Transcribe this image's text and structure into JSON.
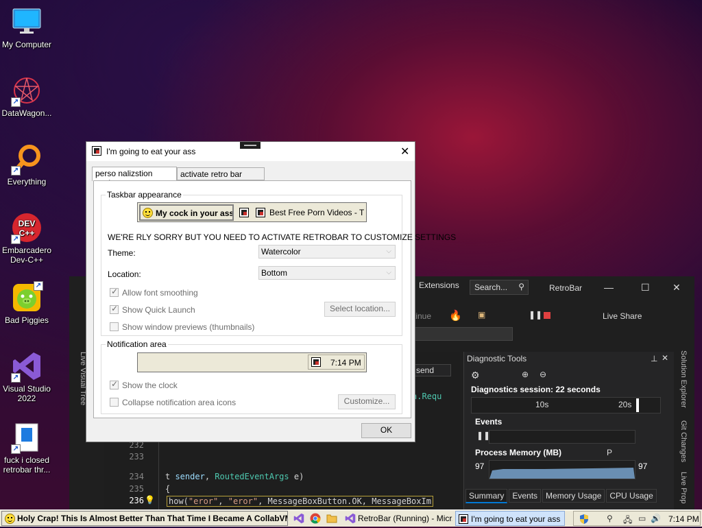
{
  "desktop": {
    "icons": [
      {
        "label": "My Computer",
        "icon": "computer-icon"
      },
      {
        "label": "DataWagon...",
        "icon": "datawagon-icon"
      },
      {
        "label": "Everything",
        "icon": "everything-search-icon"
      },
      {
        "label": "Embarcadero Dev-C++",
        "icon": "devcpp-icon",
        "badge": "DEV C++"
      },
      {
        "label": "Bad Piggies",
        "icon": "bad-piggies-icon"
      },
      {
        "label": "Visual Studio 2022",
        "icon": "visual-studio-icon"
      },
      {
        "label": "fuck i closed retrobar thr...",
        "icon": "document-icon"
      }
    ]
  },
  "vs": {
    "menu_extensions": "Extensions",
    "search": "Search...",
    "title": "RetroBar",
    "continue": "tinue",
    "live_share": "Live Share",
    "send_dropdown": "send",
    "live_visual_tree": "Live Visual Tree",
    "solution_explorer": "Solution Explorer",
    "git_changes": "Git Changes",
    "live_prop": "Live Prop",
    "code_lines": [
      {
        "num": "232",
        "text": ""
      },
      {
        "num": "233",
        "text": ""
      },
      {
        "num": "234",
        "text_a": "t ",
        "text_b": "sender",
        "text_c": ", ",
        "text_d": "RoutedEventArgs",
        "text_e": " e)"
      },
      {
        "num": "235",
        "text": "{"
      },
      {
        "num": "236",
        "text_a": "how(",
        "text_b": "\"eror\"",
        "text_c": ", ",
        "text_d": "\"eror\"",
        "text_e": ", MessageBoxButton.OK, MessageBoxIm"
      }
    ],
    "requ_fragment": "n.Requ",
    "diagnostics": {
      "title": "Diagnostic Tools",
      "session": "Diagnostics session: 22 seconds",
      "tick1": "10s",
      "tick2": "20s",
      "events": "Events",
      "process_memory": "Process Memory (MB)",
      "mem_left": "97",
      "mem_right": "97",
      "legend_p": "P",
      "tabs": [
        "Summary",
        "Events",
        "Memory Usage",
        "CPU Usage"
      ]
    }
  },
  "dialog": {
    "title": "I'm going to eat your ass",
    "tabs": [
      "perso nalizstion setting",
      "activate retro bar now!!"
    ],
    "taskbar_group": "Taskbar appearance",
    "preview_start": "My cock in your ass",
    "preview_task": "Best Free Porn Videos - T...",
    "warning": "WE'RE RLY SORRY BUT YOU NEED TO ACTIVATE RETROBAR TO CUSTOMIZE SETTINGS",
    "theme_label": "Theme:",
    "theme_value": "Watercolor",
    "location_label": "Location:",
    "location_value": "Bottom",
    "opt_font_smoothing": "Allow font smoothing",
    "opt_quick_launch": "Show Quick Launch",
    "select_location": "Select location...",
    "opt_previews": "Show window previews (thumbnails)",
    "notification_group": "Notification area",
    "preview_clock": "7:14 PM",
    "opt_show_clock": "Show the clock",
    "opt_collapse": "Collapse notification area icons",
    "customize": "Customize...",
    "ok": "OK",
    "checks": {
      "font_smoothing": true,
      "quick_launch": true,
      "previews": false,
      "show_clock": true,
      "collapse": false
    }
  },
  "taskbar": {
    "start_label": "Holy Crap! This Is Almost Better Than That Time I Became A CollabVM!",
    "tasks": [
      {
        "label": "RetroBar (Running) - Micr...",
        "icon": "visual-studio-icon"
      },
      {
        "label": "I'm going to eat your ass",
        "icon": "app-icon",
        "active": true
      }
    ],
    "clock": "7:14 PM"
  }
}
